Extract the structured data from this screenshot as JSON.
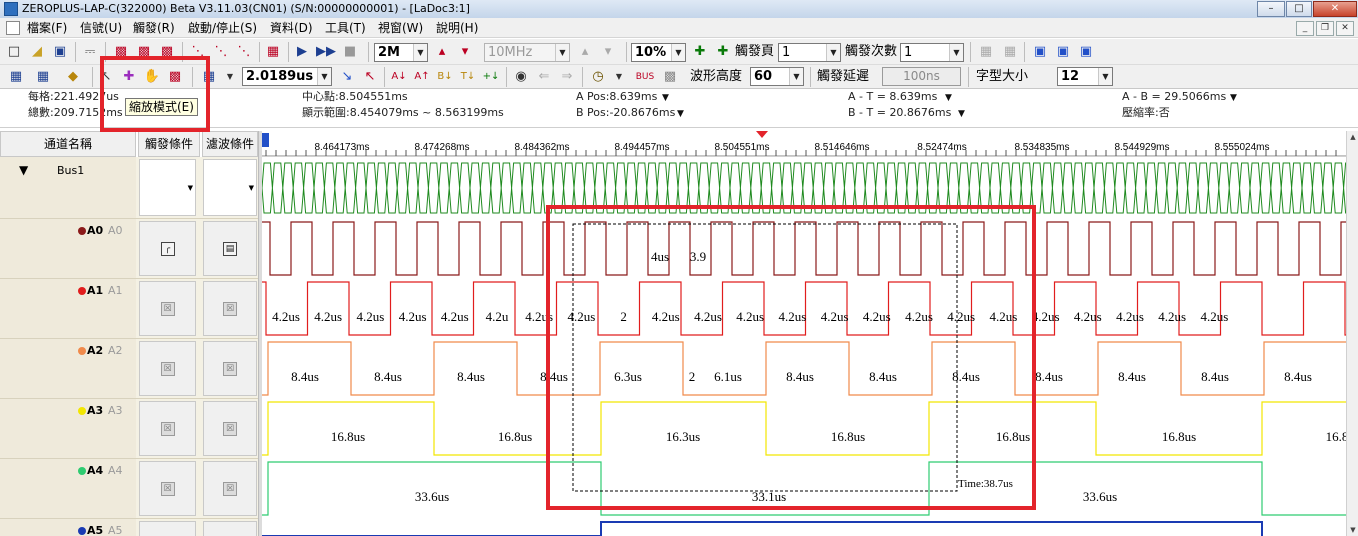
{
  "window": {
    "title": "ZEROPLUS-LAP-C(322000) Beta V3.11.03(CN01) (S/N:00000000001) - [LaDoc3:1]",
    "controls": [
      "–",
      "□",
      "✕"
    ]
  },
  "menu": {
    "items": [
      "檔案(F)",
      "信號(U)",
      "觸發(R)",
      "啟動/停止(S)",
      "資料(D)",
      "工具(T)",
      "視窗(W)",
      "說明(H)"
    ],
    "mdi": [
      "_",
      "❐",
      "✕"
    ]
  },
  "toolbar1": {
    "memory": "2M",
    "frequency": "10MHz",
    "percent": "10%",
    "trigger_page_label": "觸發頁",
    "trigger_page": "1",
    "trigger_count_label": "觸發次數",
    "trigger_count": "1"
  },
  "toolbar2": {
    "time_per_div": "2.0189us",
    "wave_height_label": "波形高度",
    "wave_height": "60",
    "trigger_delay_label": "觸發延遲",
    "trigger_delay": "100ns",
    "font_size_label": "字型大小",
    "font_size": "12"
  },
  "tooltip": "縮放模式(E)",
  "info": {
    "per_div": "每格:221.4927us",
    "total": "總數:209.7152ms",
    "center": "中心點:8.504551ms",
    "range": "顯示範圍:8.454079ms ~ 8.563199ms",
    "a_pos": "A Pos:8.639ms",
    "b_pos": "B Pos:-20.8676ms",
    "a_t": "A - T = 8.639ms",
    "b_t": "B - T = 20.8676ms",
    "a_b": "A - B = 29.5066ms",
    "compress": "壓縮率:否"
  },
  "columns": {
    "name": "通道名稱",
    "trigger": "觸發條件",
    "filter": "濾波條件"
  },
  "channels": [
    {
      "label": "Bus1",
      "sub": "",
      "color": ""
    },
    {
      "label": "A0",
      "sub": "A0",
      "color": "#8b1a1a"
    },
    {
      "label": "A1",
      "sub": "A1",
      "color": "#e11d1d"
    },
    {
      "label": "A2",
      "sub": "A2",
      "color": "#f08a4b"
    },
    {
      "label": "A3",
      "sub": "A3",
      "color": "#f2e600"
    },
    {
      "label": "A4",
      "sub": "A4",
      "color": "#2ecc71"
    },
    {
      "label": "A5",
      "sub": "A5",
      "color": "#1a3bb3"
    }
  ],
  "ruler": {
    "ticks": [
      "8.464173ms",
      "8.474268ms",
      "8.484362ms",
      "8.494457ms",
      "8.504551ms",
      "8.514646ms",
      "8.52474ms",
      "8.534835ms",
      "8.544929ms",
      "8.555024ms"
    ]
  },
  "wave_labels": {
    "a0": [
      "4us",
      "3.9"
    ],
    "a1": [
      "4.2us",
      "4.2us",
      "4.2us",
      "4.2us",
      "4.2us",
      "4.2u",
      "4.2us",
      "4.2us",
      "2",
      "4.2us",
      "4.2us",
      "4.2us",
      "4.2us",
      "4.2us",
      "4.2us",
      "4.2us",
      "4.2us",
      "4.2us",
      "4.2us",
      "4.2us",
      "4.2us",
      "4.2us",
      "4.2us"
    ],
    "a2": [
      "8.4us",
      "8.4us",
      "8.4us",
      "8.4us",
      "6.3us",
      "2",
      "6.1us",
      "8.4us",
      "8.4us",
      "8.4us",
      "8.4us",
      "8.4us",
      "8.4us",
      "8.4us"
    ],
    "a3": [
      "16.8us",
      "16.8us",
      "16.3us",
      "16.8us",
      "16.8us",
      "16.8us",
      "16.8"
    ],
    "a4": [
      "33.6us",
      "33.1us",
      "33.6us"
    ],
    "measure": "Time:38.7us"
  }
}
